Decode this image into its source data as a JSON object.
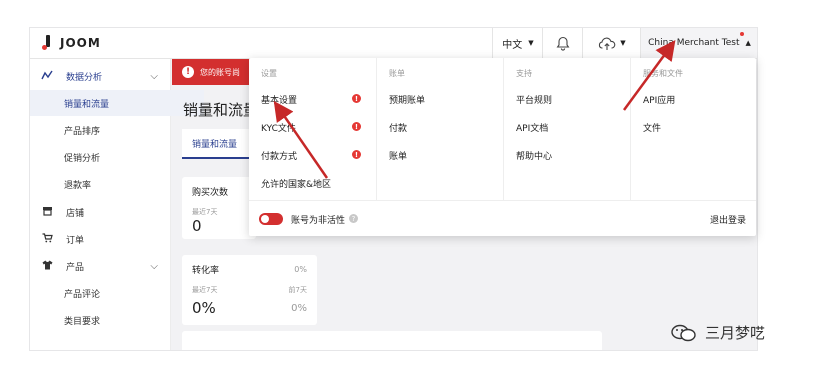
{
  "header": {
    "logo_text": "JOOM",
    "language": "中文",
    "account_name": "China Merchant Test"
  },
  "sidebar": {
    "items": [
      {
        "label": "数据分析",
        "icon": "analytics-icon"
      },
      {
        "label": "销量和流量"
      },
      {
        "label": "产品排序"
      },
      {
        "label": "促销分析"
      },
      {
        "label": "退款率"
      },
      {
        "label": "店铺",
        "icon": "store-icon"
      },
      {
        "label": "订单",
        "icon": "cart-icon"
      },
      {
        "label": "产品",
        "icon": "shirt-icon"
      },
      {
        "label": "产品评论"
      },
      {
        "label": "类目要求"
      }
    ]
  },
  "main": {
    "alert_text": "您的账号尚",
    "page_title": "销量和流量",
    "tab_label": "销量和流量",
    "cards": [
      {
        "title": "购买次数",
        "sub": "最近7天",
        "value": "0"
      },
      {
        "title": "转化率",
        "sub": "最近7天",
        "value": "0%",
        "right_top": "0%",
        "right_sub": "前7天",
        "right_value": "0%"
      }
    ]
  },
  "dropdown": {
    "columns": [
      {
        "header": "设置",
        "items": [
          "基本设置",
          "KYC文件",
          "付款方式",
          "允许的国家&地区"
        ]
      },
      {
        "header": "账单",
        "items": [
          "预期账单",
          "付款",
          "账单"
        ]
      },
      {
        "header": "支持",
        "items": [
          "平台规则",
          "API文档",
          "帮助中心"
        ]
      },
      {
        "header": "服务和文件",
        "items": [
          "API应用",
          "文件"
        ]
      }
    ],
    "inactive_label": "账号为非活性",
    "logout_label": "退出登录"
  },
  "watermark": {
    "text": "三月梦呓"
  },
  "colors": {
    "accent": "#2a3f8f",
    "alert": "#d32f2f",
    "arrow": "#c62828"
  }
}
